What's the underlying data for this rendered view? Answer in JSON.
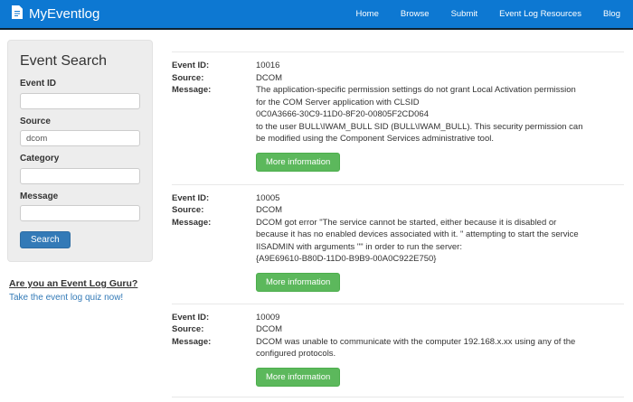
{
  "header": {
    "brand": "MyEventlog",
    "nav": [
      {
        "label": "Home"
      },
      {
        "label": "Browse"
      },
      {
        "label": "Submit"
      },
      {
        "label": "Event Log Resources"
      },
      {
        "label": "Blog"
      }
    ]
  },
  "search_panel": {
    "title": "Event Search",
    "fields": [
      {
        "label": "Event ID",
        "value": ""
      },
      {
        "label": "Source",
        "value": "dcom"
      },
      {
        "label": "Category",
        "value": ""
      },
      {
        "label": "Message",
        "value": ""
      }
    ],
    "search_button": "Search"
  },
  "quiz": {
    "question": "Are you an Event Log Guru?",
    "link": "Take the event log quiz now!"
  },
  "results": {
    "labels": {
      "event_id": "Event ID:",
      "source": "Source:",
      "message": "Message:"
    },
    "more_info_label": "More information",
    "events": [
      {
        "event_id": "10016",
        "source": "DCOM",
        "message": "The application-specific permission settings do not grant Local Activation permission\nfor the COM Server application with CLSID\n0C0A3666-30C9-11D0-8F20-00805F2CD064\nto the user BULL\\IWAM_BULL SID (BULL\\IWAM_BULL). This security permission can\nbe modified using the Component Services administrative tool."
      },
      {
        "event_id": "10005",
        "source": "DCOM",
        "message": "DCOM got error \"The service cannot be started, either because it is disabled or\nbecause it has no enabled devices associated with it. \" attempting to start the service\nIISADMIN with arguments \"\" in order to run the server:\n{A9E69610-B80D-11D0-B9B9-00A0C922E750}"
      },
      {
        "event_id": "10009",
        "source": "DCOM",
        "message": "DCOM was unable to communicate with the computer 192.168.x.xx using any of the\nconfigured protocols."
      }
    ]
  },
  "colors": {
    "header_bg": "#0d78d2",
    "header_border": "#0d2233",
    "panel_bg": "#ededed",
    "primary_button": "#337ab7",
    "success_button": "#5cb85c",
    "link": "#337ab7",
    "divider": "#e8e8e8",
    "text": "#333333"
  }
}
